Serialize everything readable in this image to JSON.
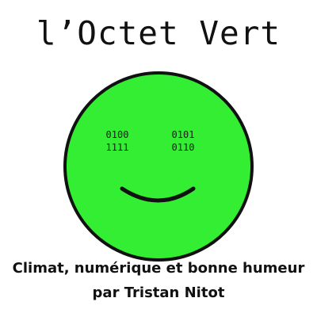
{
  "title": "l’Octet Vert",
  "logo": {
    "icon": "smiley-face-icon",
    "face_color": "#33ee33",
    "outline_color": "#111111",
    "left_eye": {
      "line1": "0100",
      "line2": "1111"
    },
    "right_eye": {
      "line1": "0101",
      "line2": "0110"
    }
  },
  "tagline": {
    "line1": "Climat, numérique et bonne humeur",
    "line2": "par Tristan Nitot"
  }
}
